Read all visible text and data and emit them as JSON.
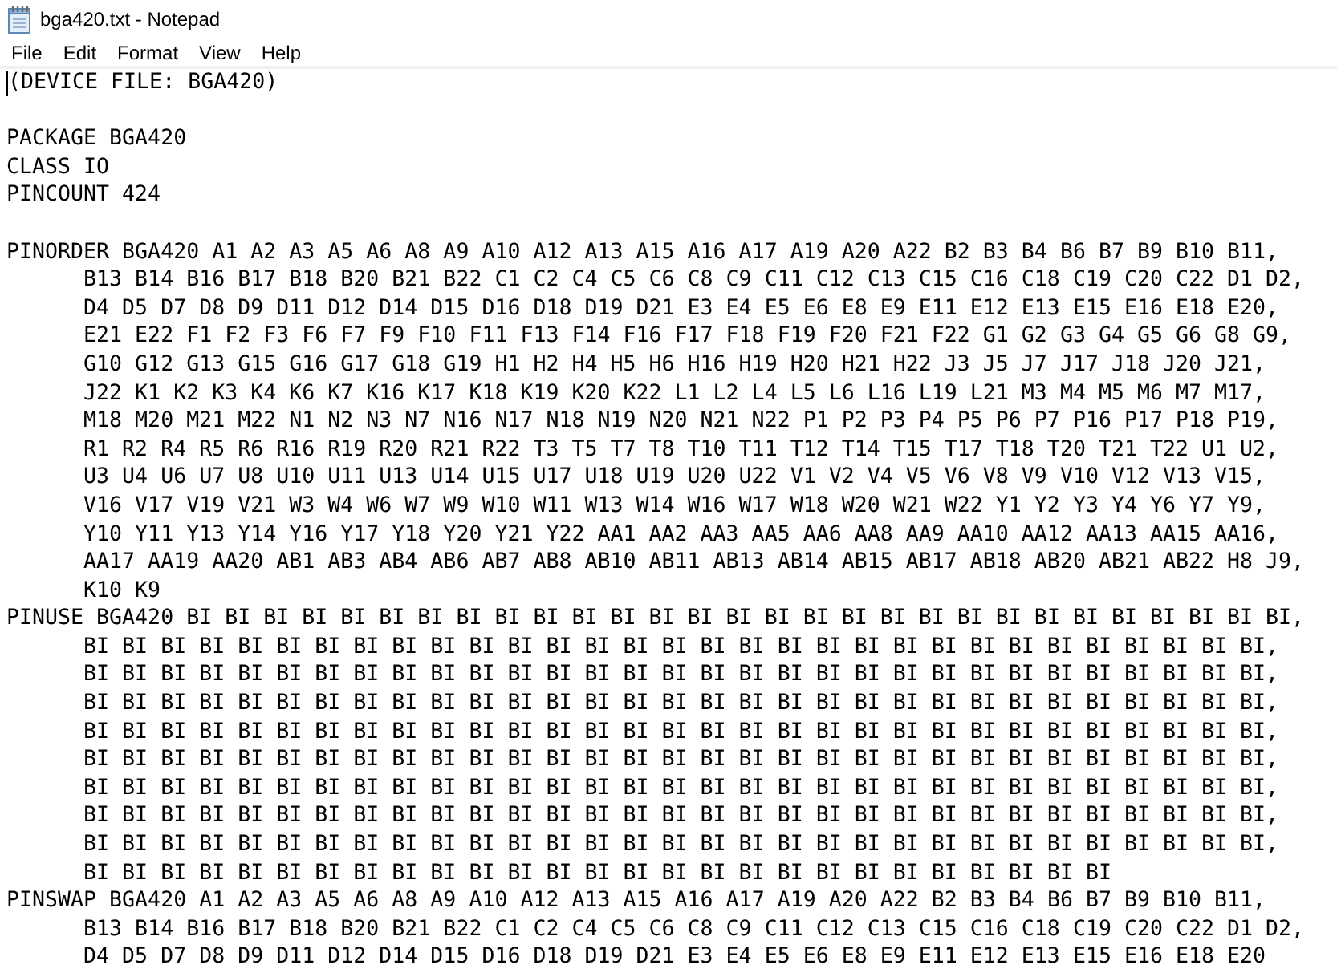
{
  "window": {
    "title": "bga420.txt - Notepad"
  },
  "menu": [
    "File",
    "Edit",
    "Format",
    "View",
    "Help"
  ],
  "document": {
    "caret_at_start": true,
    "sections": [
      {
        "statements": [
          {
            "lines": [
              "(DEVICE FILE: BGA420)"
            ]
          }
        ]
      },
      {
        "statements": [
          {
            "lines": [
              "PACKAGE BGA420"
            ]
          },
          {
            "lines": [
              "CLASS IO"
            ]
          },
          {
            "lines": [
              "PINCOUNT 424"
            ]
          }
        ]
      },
      {
        "statements": [
          {
            "lines": [
              "PINORDER BGA420 A1 A2 A3 A5 A6 A8 A9 A10 A12 A13 A15 A16 A17 A19 A20 A22 B2 B3 B4 B6 B7 B9 B10 B11,",
              "B13 B14 B16 B17 B18 B20 B21 B22 C1 C2 C4 C5 C6 C8 C9 C11 C12 C13 C15 C16 C18 C19 C20 C22 D1 D2,",
              "D4 D5 D7 D8 D9 D11 D12 D14 D15 D16 D18 D19 D21 E3 E4 E5 E6 E8 E9 E11 E12 E13 E15 E16 E18 E20,",
              "E21 E22 F1 F2 F3 F6 F7 F9 F10 F11 F13 F14 F16 F17 F18 F19 F20 F21 F22 G1 G2 G3 G4 G5 G6 G8 G9,",
              "G10 G12 G13 G15 G16 G17 G18 G19 H1 H2 H4 H5 H6 H16 H19 H20 H21 H22 J3 J5 J7 J17 J18 J20 J21,",
              "J22 K1 K2 K3 K4 K6 K7 K16 K17 K18 K19 K20 K22 L1 L2 L4 L5 L6 L16 L19 L21 M3 M4 M5 M6 M7 M17,",
              "M18 M20 M21 M22 N1 N2 N3 N7 N16 N17 N18 N19 N20 N21 N22 P1 P2 P3 P4 P5 P6 P7 P16 P17 P18 P19,",
              "R1 R2 R4 R5 R6 R16 R19 R20 R21 R22 T3 T5 T7 T8 T10 T11 T12 T14 T15 T17 T18 T20 T21 T22 U1 U2,",
              "U3 U4 U6 U7 U8 U10 U11 U13 U14 U15 U17 U18 U19 U20 U22 V1 V2 V4 V5 V6 V8 V9 V10 V12 V13 V15,",
              "V16 V17 V19 V21 W3 W4 W6 W7 W9 W10 W11 W13 W14 W16 W17 W18 W20 W21 W22 Y1 Y2 Y3 Y4 Y6 Y7 Y9,",
              "Y10 Y11 Y13 Y14 Y16 Y17 Y18 Y20 Y21 Y22 AA1 AA2 AA3 AA5 AA6 AA8 AA9 AA10 AA12 AA13 AA15 AA16,",
              "AA17 AA19 AA20 AB1 AB3 AB4 AB6 AB7 AB8 AB10 AB11 AB13 AB14 AB15 AB17 AB18 AB20 AB21 AB22 H8 J9,",
              "K10 K9"
            ]
          },
          {
            "lines": [
              "PINUSE BGA420 BI BI BI BI BI BI BI BI BI BI BI BI BI BI BI BI BI BI BI BI BI BI BI BI BI BI BI BI BI,",
              "BI BI BI BI BI BI BI BI BI BI BI BI BI BI BI BI BI BI BI BI BI BI BI BI BI BI BI BI BI BI BI,",
              "BI BI BI BI BI BI BI BI BI BI BI BI BI BI BI BI BI BI BI BI BI BI BI BI BI BI BI BI BI BI BI,",
              "BI BI BI BI BI BI BI BI BI BI BI BI BI BI BI BI BI BI BI BI BI BI BI BI BI BI BI BI BI BI BI,",
              "BI BI BI BI BI BI BI BI BI BI BI BI BI BI BI BI BI BI BI BI BI BI BI BI BI BI BI BI BI BI BI,",
              "BI BI BI BI BI BI BI BI BI BI BI BI BI BI BI BI BI BI BI BI BI BI BI BI BI BI BI BI BI BI BI,",
              "BI BI BI BI BI BI BI BI BI BI BI BI BI BI BI BI BI BI BI BI BI BI BI BI BI BI BI BI BI BI BI,",
              "BI BI BI BI BI BI BI BI BI BI BI BI BI BI BI BI BI BI BI BI BI BI BI BI BI BI BI BI BI BI BI,",
              "BI BI BI BI BI BI BI BI BI BI BI BI BI BI BI BI BI BI BI BI BI BI BI BI BI BI BI BI BI BI BI,",
              "BI BI BI BI BI BI BI BI BI BI BI BI BI BI BI BI BI BI BI BI BI BI BI BI BI BI BI"
            ]
          },
          {
            "lines": [
              "PINSWAP BGA420 A1 A2 A3 A5 A6 A8 A9 A10 A12 A13 A15 A16 A17 A19 A20 A22 B2 B3 B4 B6 B7 B9 B10 B11,",
              "B13 B14 B16 B17 B18 B20 B21 B22 C1 C2 C4 C5 C6 C8 C9 C11 C12 C13 C15 C16 C18 C19 C20 C22 D1 D2,",
              "D4 D5 D7 D8 D9 D11 D12 D14 D15 D16 D18 D19 D21 E3 E4 E5 E6 E8 E9 E11 E12 E13 E15 E16 E18 E20"
            ]
          }
        ]
      }
    ]
  }
}
